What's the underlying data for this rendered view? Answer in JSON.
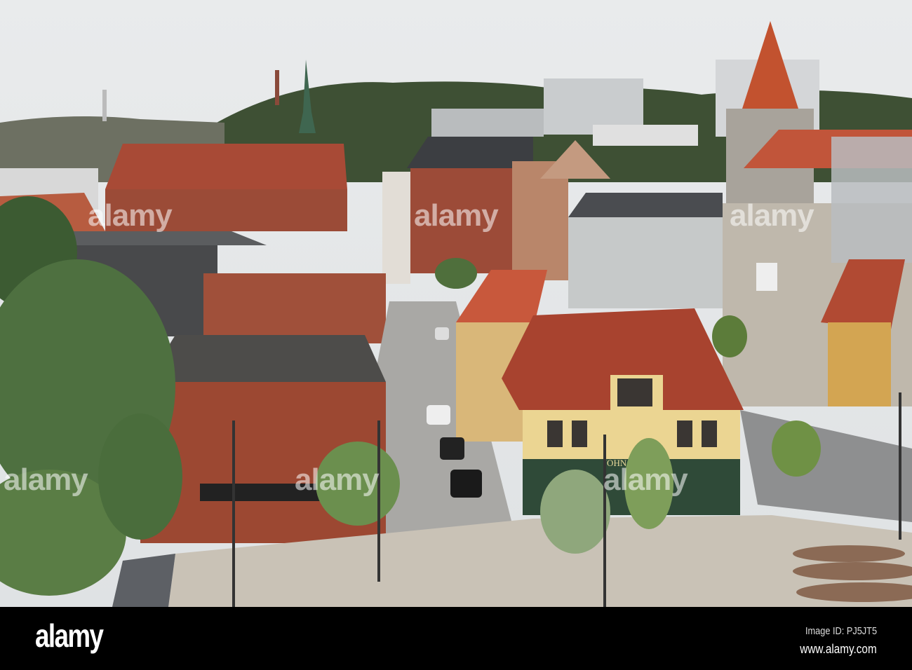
{
  "photo": {
    "subject": "Aalborg city street view",
    "signs": {
      "pub": "JOHN B"
    }
  },
  "watermark": {
    "text": "alamy"
  },
  "footer": {
    "logo": "alamy",
    "image_id": "Image ID: PJ5JT5",
    "website": "www.alamy.com"
  },
  "colors": {
    "sky": "#e6e8ea",
    "roof_red": "#b04a35",
    "brick": "#9a4a35",
    "footer": "#000000"
  }
}
